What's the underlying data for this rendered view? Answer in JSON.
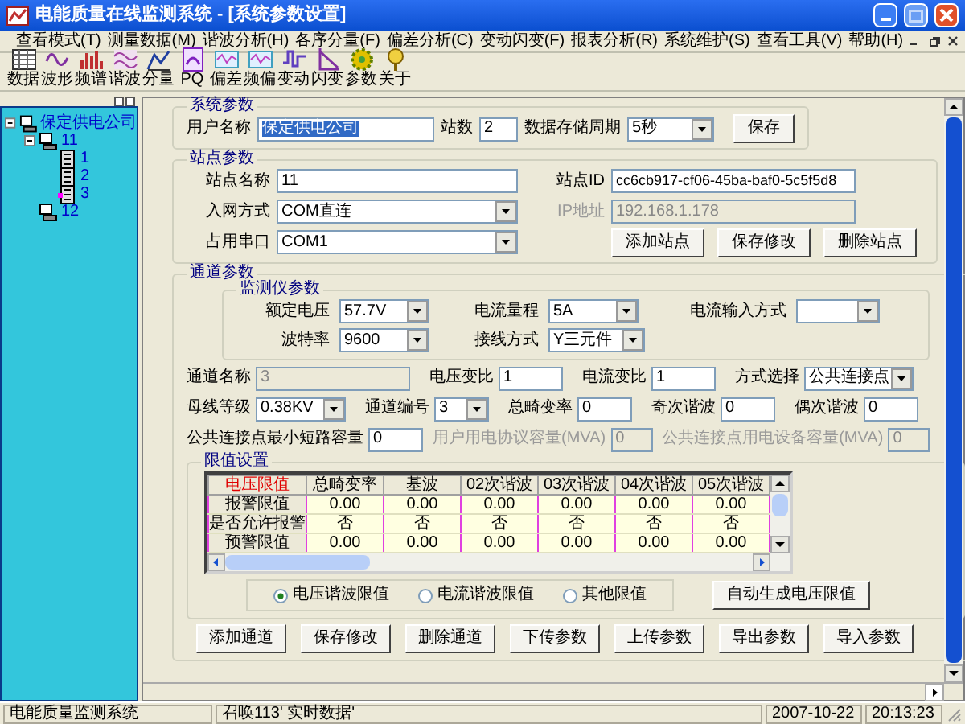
{
  "window": {
    "title": "电能质量在线监测系统 - [系统参数设置]"
  },
  "menu": [
    "查看模式(T)",
    "测量数据(M)",
    "谐波分析(H)",
    "各序分量(F)",
    "偏差分析(C)",
    "变动闪变(F)",
    "报表分析(R)",
    "系统维护(S)",
    "查看工具(V)",
    "帮助(H)"
  ],
  "toolbar": [
    {
      "label": "数据",
      "kind": "table"
    },
    {
      "label": "波形",
      "kind": "wave"
    },
    {
      "label": "频谱",
      "kind": "bars"
    },
    {
      "label": "谐波",
      "kind": "harmonic"
    },
    {
      "label": "分量",
      "kind": "component"
    },
    {
      "label": "PQ",
      "kind": "pq"
    },
    {
      "label": "偏差",
      "kind": "deviation"
    },
    {
      "label": "频偏",
      "kind": "deviation"
    },
    {
      "label": "变动",
      "kind": "pulse"
    },
    {
      "label": "闪变",
      "kind": "slope"
    },
    {
      "label": "参数",
      "kind": "gear"
    },
    {
      "label": "关于",
      "kind": "help"
    }
  ],
  "tree": [
    {
      "label": "保定供电公司",
      "kind": "station",
      "expanded": true,
      "children": [
        {
          "label": "11",
          "kind": "station",
          "expanded": true,
          "children": [
            {
              "label": "1",
              "kind": "device"
            },
            {
              "label": "2",
              "kind": "device"
            },
            {
              "label": "3",
              "kind": "device_alert"
            }
          ]
        },
        {
          "label": "12",
          "kind": "station"
        }
      ]
    }
  ],
  "system_params": {
    "title": "系统参数",
    "fields": [
      {
        "label": "用户名称",
        "value": "保定供电公司",
        "kind": "text",
        "highlighted": true
      },
      {
        "label": "站数",
        "value": "2",
        "kind": "text"
      },
      {
        "label": "数据存储周期",
        "value": "5秒",
        "kind": "select"
      }
    ],
    "button": "保存"
  },
  "site_params": {
    "title": "站点参数",
    "fields": [
      {
        "label": "站点名称",
        "value": "11",
        "kind": "text",
        "disabled": false
      },
      {
        "label": "站点ID",
        "value": "cc6cb917-cf06-45ba-baf0-5c5f5d8",
        "kind": "text",
        "disabled": false
      },
      {
        "label": "入网方式",
        "value": "COM直连",
        "kind": "select",
        "disabled": false
      },
      {
        "label": "IP地址",
        "value": "192.168.1.178",
        "kind": "text",
        "disabled": true
      },
      {
        "label": "占用串口",
        "value": "COM1",
        "kind": "select",
        "disabled": false
      }
    ],
    "buttons": [
      "添加站点",
      "保存修改",
      "删除站点"
    ]
  },
  "channel_params": {
    "title": "通道参数",
    "monitor": {
      "title": "监测仪参数",
      "fields": [
        {
          "label": "额定电压",
          "value": "57.7V",
          "kind": "select"
        },
        {
          "label": "电流量程",
          "value": "5A",
          "kind": "select"
        },
        {
          "label": "电流输入方式",
          "kind": "select"
        },
        {
          "label": "波特率",
          "value": "9600",
          "kind": "select"
        },
        {
          "label": "接线方式",
          "value": "Y三元件",
          "kind": "select"
        }
      ]
    },
    "field_lines": [
      {
        "fields": [
          {
            "label": "通道名称",
            "value": "3",
            "kind": "text",
            "disabled": true
          },
          {
            "label": "电压变比",
            "value": "1",
            "kind": "text",
            "disabled": false
          },
          {
            "label": "电流变比",
            "value": "1",
            "kind": "text",
            "disabled": false
          },
          {
            "label": "方式选择",
            "value": "公共连接点",
            "kind": "select",
            "disabled": false
          }
        ]
      },
      {
        "fields": [
          {
            "label": "母线等级",
            "value": "0.38KV",
            "kind": "select",
            "disabled": false
          },
          {
            "label": "通道编号",
            "value": "3",
            "kind": "select",
            "disabled": false
          },
          {
            "label": "总畸变率",
            "value": "0",
            "kind": "text",
            "disabled": false
          },
          {
            "label": "奇次谐波",
            "value": "0",
            "kind": "text",
            "disabled": false
          },
          {
            "label": "偶次谐波",
            "value": "0",
            "kind": "text",
            "disabled": false
          }
        ]
      },
      {
        "fields": [
          {
            "label": "公共连接点最小短路容量",
            "value": "0",
            "kind": "text",
            "disabled": false
          },
          {
            "label": "用户用电协议容量(MVA)",
            "value": "0",
            "kind": "text",
            "disabled": true
          },
          {
            "label": "公共连接点用电设备容量(MVA)",
            "value": "0",
            "kind": "text",
            "disabled": true
          }
        ]
      }
    ],
    "limits": {
      "title": "限值设置",
      "table": {
        "columns": [
          "电压限值",
          "总畸变率",
          "基波",
          "02次谐波",
          "03次谐波",
          "04次谐波",
          "05次谐波"
        ],
        "rows": [
          [
            "报警限值",
            "0.00",
            "0.00",
            "0.00",
            "0.00",
            "0.00",
            "0.00"
          ],
          [
            "是否允许报警",
            "否",
            "否",
            "否",
            "否",
            "否",
            "否"
          ],
          [
            "预警限值",
            "0.00",
            "0.00",
            "0.00",
            "0.00",
            "0.00",
            "0.00"
          ]
        ]
      },
      "radios": [
        {
          "label": "电压谐波限值",
          "selected": true
        },
        {
          "label": "电流谐波限值",
          "selected": false
        },
        {
          "label": "其他限值",
          "selected": false
        }
      ],
      "button": "自动生成电压限值"
    },
    "buttons": [
      "添加通道",
      "保存修改",
      "删除通道",
      "下传参数",
      "上传参数",
      "导出参数",
      "导入参数"
    ]
  },
  "status_bar": [
    "电能质量监测系统",
    "召唤113' 实时数据'",
    "2007-10-22",
    "20:13:23"
  ]
}
